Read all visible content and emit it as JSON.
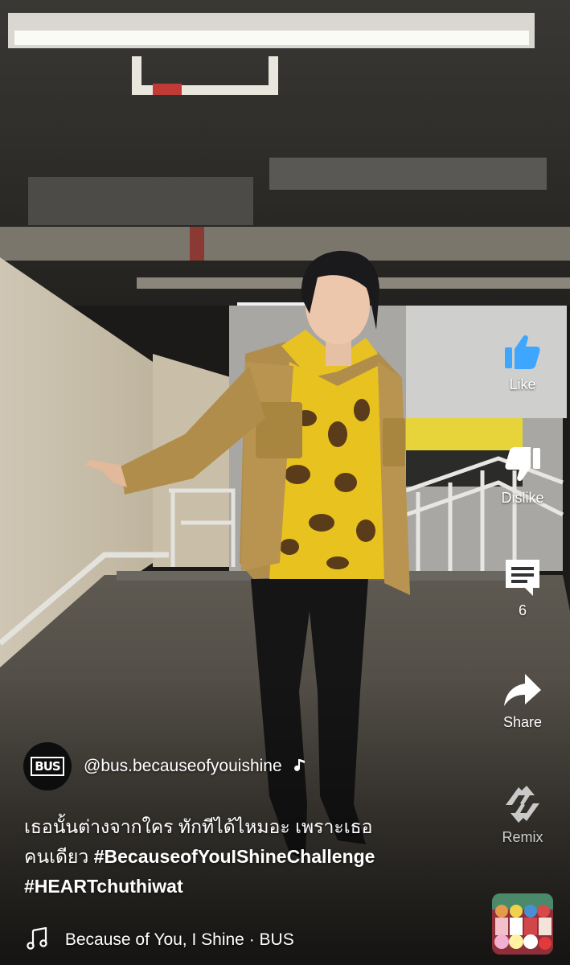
{
  "channel": {
    "avatar_text": "BUS",
    "handle": "@bus.becauseofyouishine"
  },
  "caption": {
    "line1": "เธอนั้นต่างจากใคร ทักทีได้ไหมอะ เพราะเธอ",
    "line2_text": "คนเดียว ",
    "hashtag1": "#BecauseofYouIShineChallenge",
    "hashtag2": "#HEARTchuthiwat"
  },
  "music": {
    "track": "Because of You, I Shine · BUS"
  },
  "actions": {
    "like_label": "Like",
    "dislike_label": "Dislike",
    "comments_count": "6",
    "share_label": "Share",
    "remix_label": "Remix"
  },
  "icons": {
    "like": "thumbs-up-icon",
    "dislike": "thumbs-down-icon",
    "comment": "comment-icon",
    "share": "share-arrow-icon",
    "remix": "remix-icon",
    "music": "music-note-icon"
  },
  "colors": {
    "like_active": "#3ea6ff",
    "text": "#ffffff"
  }
}
